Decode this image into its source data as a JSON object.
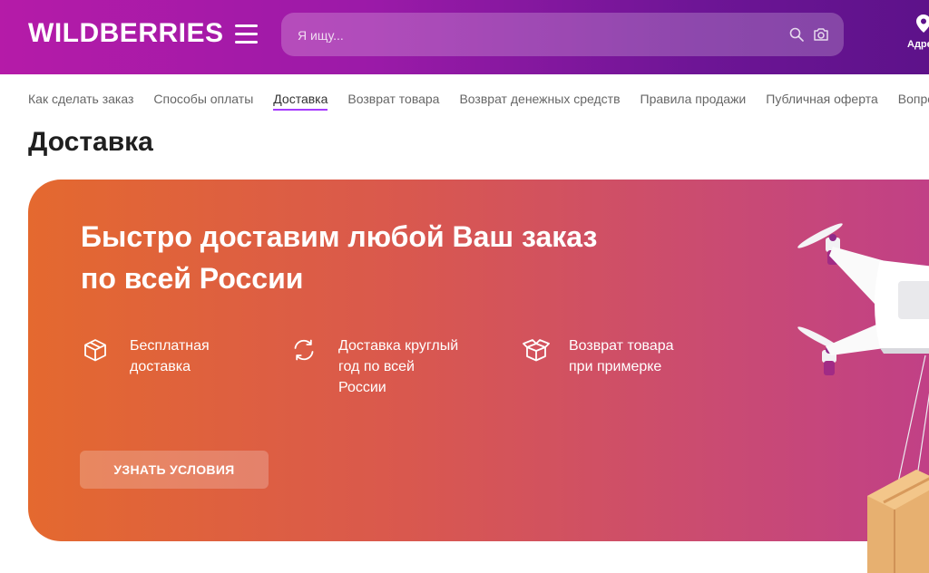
{
  "header": {
    "logo": "WILDBERRIES",
    "search_placeholder": "Я ищу...",
    "address_label": "Адрес"
  },
  "nav": [
    {
      "label": "Как сделать заказ",
      "active": false
    },
    {
      "label": "Способы оплаты",
      "active": false
    },
    {
      "label": "Доставка",
      "active": true
    },
    {
      "label": "Возврат товара",
      "active": false
    },
    {
      "label": "Возврат денежных средств",
      "active": false
    },
    {
      "label": "Правила продажи",
      "active": false
    },
    {
      "label": "Публичная оферта",
      "active": false
    },
    {
      "label": "Вопросы",
      "active": false
    }
  ],
  "page": {
    "title": "Доставка"
  },
  "banner": {
    "title_line1": "Быстро доставим любой Ваш заказ",
    "title_line2": "по всей России",
    "features": [
      {
        "icon": "box-icon",
        "line1": "Бесплатная",
        "line2": "доставка",
        "line3": ""
      },
      {
        "icon": "refresh-icon",
        "line1": "Доставка круглый",
        "line2": "год по всей",
        "line3": "России"
      },
      {
        "icon": "open-box-icon",
        "line1": "Возврат товара",
        "line2": "при примерке",
        "line3": ""
      }
    ],
    "cta_label": "УЗНАТЬ УСЛОВИЯ"
  },
  "colors": {
    "header_start": "#b51ba8",
    "header_end": "#5d128a",
    "banner_start": "#e4692f",
    "banner_end": "#bf3e8a",
    "nav_active_underline": "#a73afd"
  }
}
